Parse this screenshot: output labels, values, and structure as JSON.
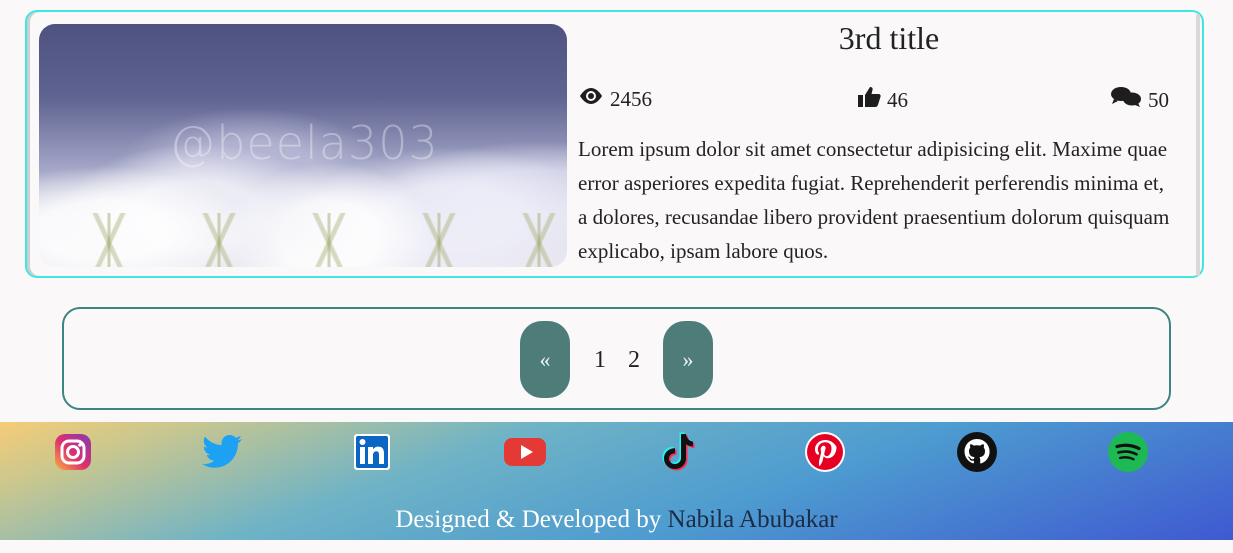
{
  "post": {
    "title": "3rd title",
    "image_watermark": "@beela303",
    "views": "2456",
    "likes": "46",
    "comments": "50",
    "description": "Lorem ipsum dolor sit amet consectetur adipisicing elit. Maxime quae error asperiores expedita fugiat. Reprehenderit perferendis minima et, a dolores, recusandae libero provident praesentium dolorum quisquam explicabo, ipsam labore quos."
  },
  "pagination": {
    "prev_label": "«",
    "pages": [
      "1",
      "2"
    ],
    "next_label": "»"
  },
  "footer": {
    "social_icons": [
      "instagram-icon",
      "twitter-icon",
      "linkedin-icon",
      "youtube-icon",
      "tiktok-icon",
      "pinterest-icon",
      "github-icon",
      "spotify-icon"
    ],
    "credit_prefix": "Designed & Developed by",
    "credit_name": "Nabila Abubakar"
  },
  "colors": {
    "card_border": "#3fe6e0",
    "pager_border": "#3d8582",
    "pager_button": "#4e7c79"
  }
}
